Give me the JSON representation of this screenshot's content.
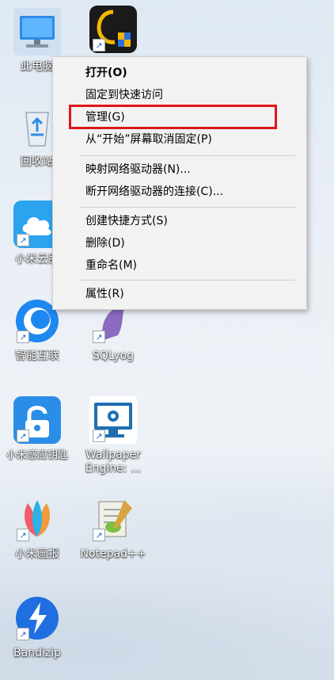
{
  "desktop": {
    "icons": [
      {
        "label": "此电脑",
        "icon": "computer-icon"
      },
      {
        "label": "",
        "icon": "app-shield-icon"
      },
      {
        "label": "回收站",
        "icon": "recycle-bin-icon"
      },
      {
        "label": "小米云服",
        "icon": "cloud-icon"
      },
      {
        "label": "智能互联",
        "icon": "swirl-icon"
      },
      {
        "label": "SQLyog",
        "icon": "dolphin-icon"
      },
      {
        "label": "小米感应钥匙",
        "icon": "lock-icon"
      },
      {
        "label": "Wallpaper Engine: ...",
        "icon": "monitor-gear-icon"
      },
      {
        "label": "小米画报",
        "icon": "petals-icon"
      },
      {
        "label": "Notepad++",
        "icon": "notepad-icon"
      },
      {
        "label": "Bandizip",
        "icon": "lightning-icon"
      }
    ]
  },
  "context_menu": {
    "items": [
      {
        "label": "打开(O)"
      },
      {
        "label": "固定到快速访问"
      },
      {
        "label": "管理(G)"
      },
      {
        "label": "从“开始”屏幕取消固定(P)"
      },
      {
        "label": "映射网络驱动器(N)..."
      },
      {
        "label": "断开网络驱动器的连接(C)..."
      },
      {
        "label": "创建快捷方式(S)"
      },
      {
        "label": "删除(D)"
      },
      {
        "label": "重命名(M)"
      },
      {
        "label": "属性(R)"
      }
    ]
  },
  "colors": {
    "highlight": "#e0151b",
    "menu_bg": "#f2f2f2"
  }
}
